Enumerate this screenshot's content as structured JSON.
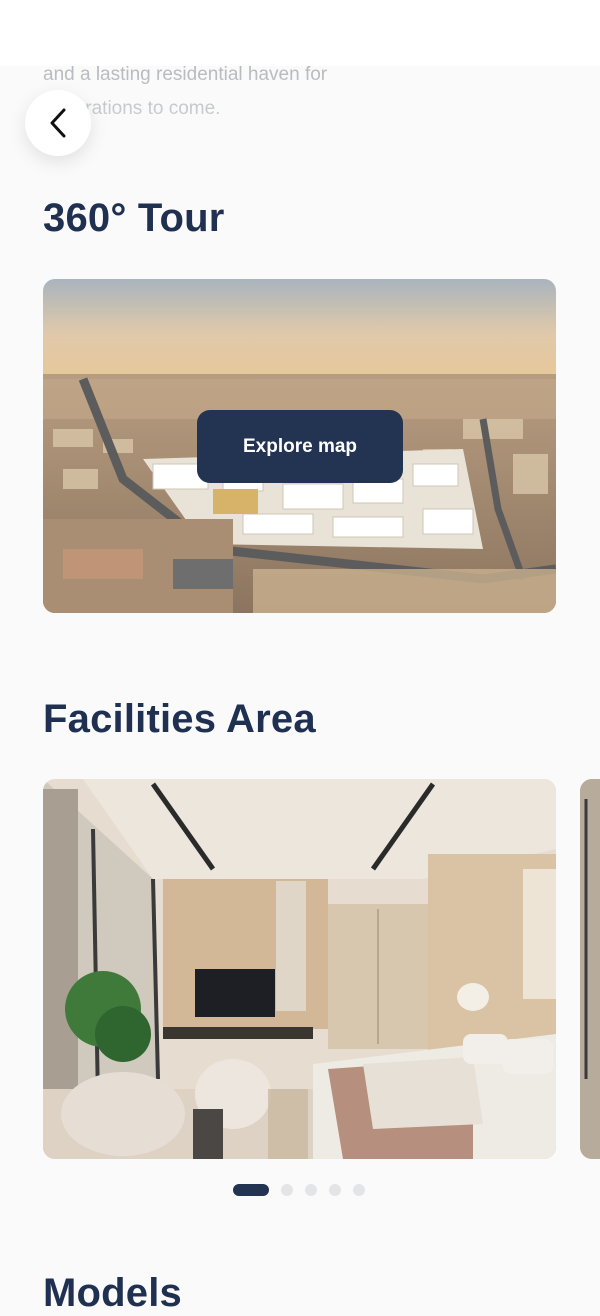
{
  "intro": {
    "line1": "and a lasting residential haven for",
    "line2": "generations to come."
  },
  "back_icon": "chevron-left-icon",
  "tour": {
    "title": "360° Tour",
    "button_label": "Explore map"
  },
  "facilities": {
    "title": "Facilities Area",
    "pagination": {
      "total": 5,
      "active": 1
    }
  },
  "models": {
    "title": "Models"
  },
  "colors": {
    "accent": "#223451",
    "heading": "#1f3050",
    "dot_inactive": "#e2e4e8"
  }
}
